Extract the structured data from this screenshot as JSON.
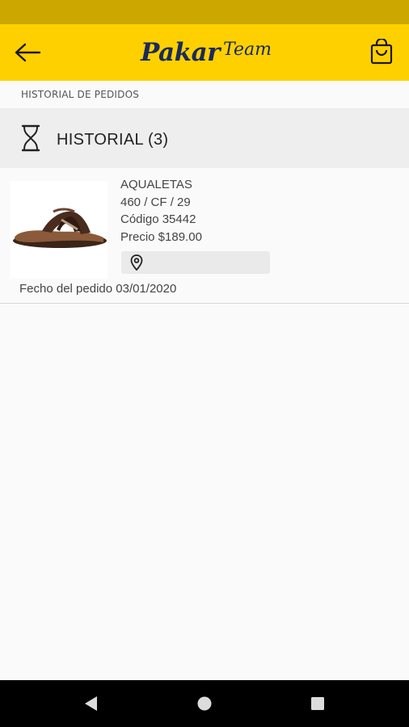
{
  "app_bar": {
    "logo_main": "Pakar",
    "logo_script": "Team"
  },
  "breadcrumb": "HISTORIAL DE PEDIDOS",
  "section": {
    "title": "HISTORIAL (3)"
  },
  "orders": [
    {
      "name": "AQUALETAS",
      "variant": "460 / CF / 29",
      "code": "Código 35442",
      "price": "Precio $189.00",
      "location": "",
      "date": "Fecho del pedido 03/01/2020"
    }
  ],
  "colors": {
    "status_bar": "#cba700",
    "app_bar": "#ffd000",
    "brand_navy": "#1a2a5c"
  },
  "icons": {
    "back": "arrow-left-icon",
    "cart": "shopping-bag-icon",
    "section": "hourglass-icon",
    "location": "map-pin-icon",
    "nav_back": "triangle-back-icon",
    "nav_home": "circle-home-icon",
    "nav_recents": "square-recents-icon"
  }
}
